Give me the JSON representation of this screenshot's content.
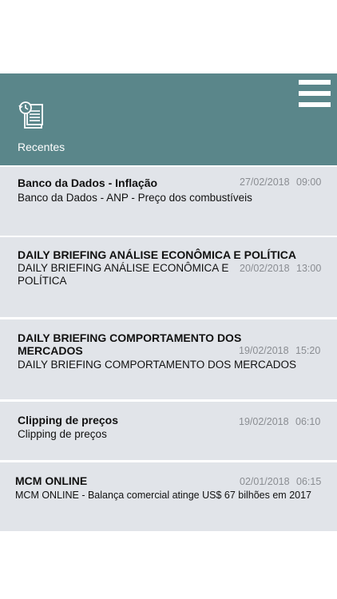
{
  "header": {
    "title": "Recentes",
    "menu_icon": "hamburger-menu-icon",
    "section_icon": "recent-documents-icon",
    "color": "#5a868a"
  },
  "items": [
    {
      "title": "Banco da Dados - Inflação",
      "subtitle": "Banco da Dados - ANP - Preço dos combustíveis",
      "date": "27/02/2018",
      "time": "09:00"
    },
    {
      "title": "DAILY BRIEFING ANÁLISE ECONÔMICA E POLÍTICA",
      "subtitle_line1": "DAILY BRIEFING ANÁLISE ECONÔMICA E",
      "subtitle_line2": "POLÍTICA",
      "date": "20/02/2018",
      "time": "13:00"
    },
    {
      "title_line1": "DAILY BRIEFING COMPORTAMENTO DOS",
      "title_line2": "MERCADOS",
      "subtitle": "DAILY BRIEFING COMPORTAMENTO DOS MERCADOS",
      "date": "19/02/2018",
      "time": "15:20"
    },
    {
      "title": "Clipping de preços",
      "subtitle": "Clipping de preços",
      "date": "19/02/2018",
      "time": "06:10"
    },
    {
      "title": "MCM ONLINE",
      "subtitle": "MCM ONLINE - Balança comercial atinge US$ 67 bilhões em 2017",
      "date": "02/01/2018",
      "time": "06:15"
    }
  ]
}
